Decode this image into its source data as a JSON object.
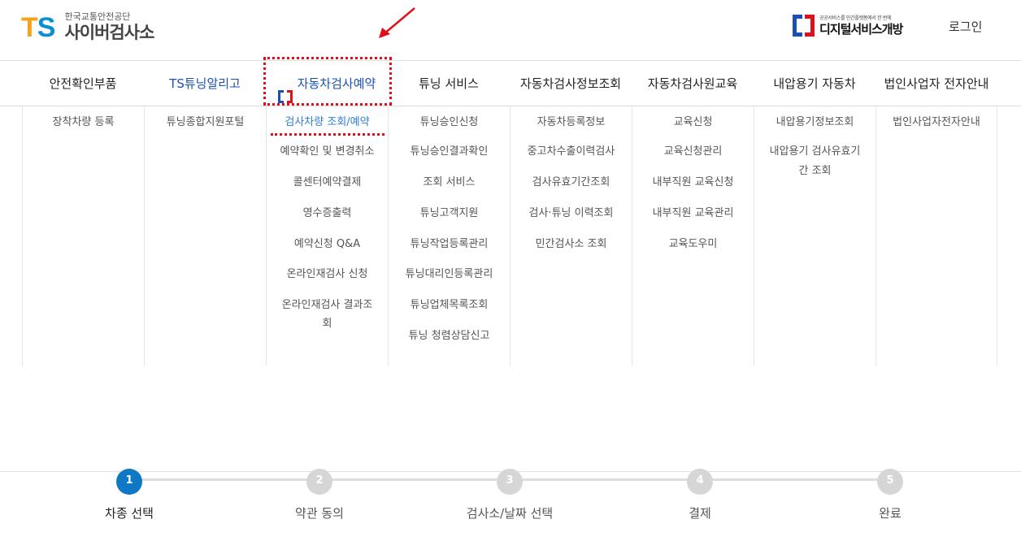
{
  "header": {
    "logo_mark": "TS",
    "org_name": "한국교통안전공단",
    "site_name": "사이버검사소",
    "digital_sub": "공공서비스를 민간플랫폼에서 한 번에",
    "digital_main": "디지털서비스개방",
    "login_label": "로그인"
  },
  "nav": {
    "items": [
      {
        "label": "안전확인부품"
      },
      {
        "label": "TS튜닝알리고"
      },
      {
        "label": "자동차검사예약"
      },
      {
        "label": "튜닝 서비스"
      },
      {
        "label": "자동차검사정보조회"
      },
      {
        "label": "자동차검사원교육"
      },
      {
        "label": "내압용기 자동차"
      },
      {
        "label": "법인사업자 전자안내"
      }
    ]
  },
  "dropdown": {
    "columns": [
      [
        "장착차량 등록"
      ],
      [
        "튜닝종합지원포털"
      ],
      [
        "검사차량 조회/예약",
        "예약확인 및 변경취소",
        "콜센터예약결제",
        "영수증출력",
        "예약신청 Q&A",
        "온라인재검사 신청",
        "온라인재검사 결과조",
        "회"
      ],
      [
        "튜닝승인신청",
        "튜닝승인결과확인",
        "조회 서비스",
        "튜닝고객지원",
        "튜닝작업등록관리",
        "튜닝대리인등록관리",
        "튜닝업체목록조회",
        "튜닝 청렴상담신고"
      ],
      [
        "자동차등록정보",
        "중고차수출이력검사",
        "검사유효기간조회",
        "검사·튜닝 이력조회",
        "민간검사소 조회"
      ],
      [
        "교육신청",
        "교육신청관리",
        "내부직원 교육신청",
        "내부직원 교육관리",
        "교육도우미"
      ],
      [
        "내압용기정보조회",
        "내압용기 검사유효기",
        "간 조회"
      ],
      [
        "법인사업자전자안내"
      ]
    ]
  },
  "steps": [
    {
      "num": "1",
      "label": "차종 선택"
    },
    {
      "num": "2",
      "label": "약관 동의"
    },
    {
      "num": "3",
      "label": "검사소/날짜 선택"
    },
    {
      "num": "4",
      "label": "결제"
    },
    {
      "num": "5",
      "label": "완료"
    }
  ],
  "colors": {
    "accent_blue": "#0f78c4",
    "highlight_red": "#e0101a",
    "link_blue": "#2e7bd6"
  }
}
